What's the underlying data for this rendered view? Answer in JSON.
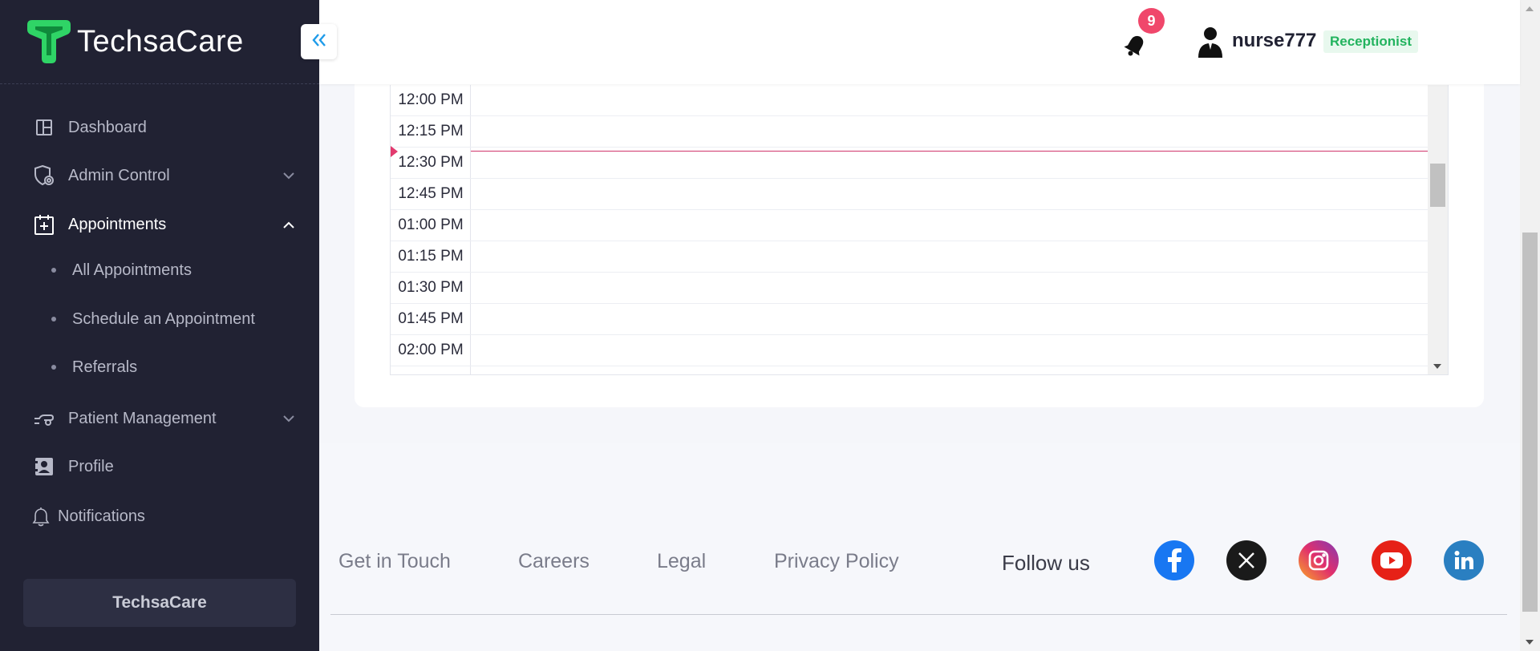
{
  "brand": {
    "name": "TechsaCare"
  },
  "sidebar": {
    "items": [
      {
        "label": "Dashboard",
        "icon": "dashboard-icon"
      },
      {
        "label": "Admin Control",
        "icon": "shield-gear-icon"
      },
      {
        "label": "Appointments",
        "icon": "calendar-plus-icon"
      },
      {
        "label": "Patient Management",
        "icon": "patient-hand-icon"
      },
      {
        "label": "Profile",
        "icon": "id-card-icon"
      },
      {
        "label": "Notifications",
        "icon": "bell-outline-icon"
      }
    ],
    "subitems": [
      {
        "label": "All Appointments"
      },
      {
        "label": "Schedule an Appointment"
      },
      {
        "label": "Referrals"
      }
    ],
    "footer_label": "TechsaCare"
  },
  "header": {
    "notification_count": "9",
    "username": "nurse777",
    "role": "Receptionist"
  },
  "schedule": {
    "times": [
      "12:00 PM",
      "12:15 PM",
      "12:30 PM",
      "12:45 PM",
      "01:00 PM",
      "01:15 PM",
      "01:30 PM",
      "01:45 PM",
      "02:00 PM"
    ],
    "now_color": "#d0366b"
  },
  "footer": {
    "links": [
      "Get in Touch",
      "Careers",
      "Legal",
      "Privacy Policy"
    ],
    "follow_label": "Follow us",
    "social": [
      {
        "name": "facebook-icon",
        "color": "#1877f2"
      },
      {
        "name": "x-icon",
        "color": "#1a1a1a"
      },
      {
        "name": "instagram-icon",
        "color": "#d62976"
      },
      {
        "name": "youtube-icon",
        "color": "#e62117"
      },
      {
        "name": "linkedin-icon",
        "color": "#2a7fc1"
      }
    ]
  },
  "colors": {
    "sidebar_bg": "#212233",
    "accent_green": "#22b35e",
    "badge_red": "#f0476b",
    "collapse_blue": "#1e9be9"
  }
}
